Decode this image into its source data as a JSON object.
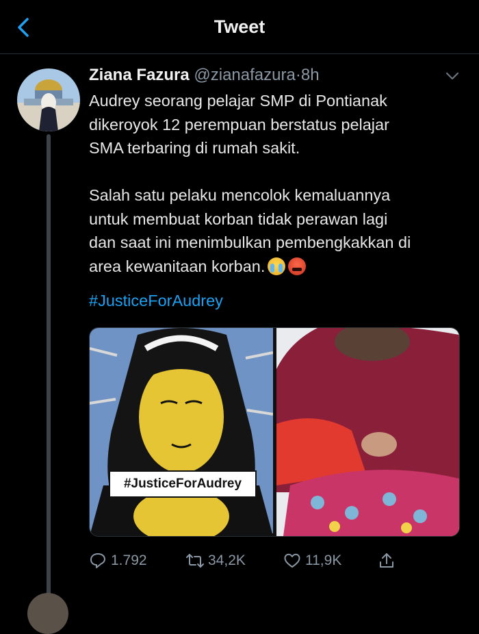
{
  "header": {
    "title": "Tweet"
  },
  "tweet": {
    "author_name": "Ziana Fazura",
    "author_handle": "@zianafazura",
    "separator": "·",
    "time": "8h",
    "paragraph1": [
      "Audrey seorang pelajar SMP di Pontianak",
      "dikeroyok 12 perempuan berstatus pelajar",
      "SMA terbaring di rumah sakit."
    ],
    "paragraph2": [
      "Salah satu pelaku mencolok kemaluannya",
      "untuk membuat korban tidak perawan lagi",
      "dan saat ini menimbulkan pembengkakkan di",
      "area kewanitaan korban."
    ],
    "emojis": [
      "crying-face",
      "angry-face-with-symbols"
    ],
    "hashtag": "#JusticeForAudrey",
    "media": {
      "image1_caption": "#JusticeForAudrey"
    },
    "stats": {
      "replies": "1.792",
      "retweets": "34,2K",
      "likes": "11,9K"
    }
  },
  "colors": {
    "background": "#000000",
    "text": "#e8e8e8",
    "muted": "#8b98a5",
    "accent": "#1da1f2"
  },
  "icons": [
    "back-chevron-icon",
    "caret-down-icon",
    "reply-icon",
    "retweet-icon",
    "like-icon",
    "share-icon"
  ]
}
